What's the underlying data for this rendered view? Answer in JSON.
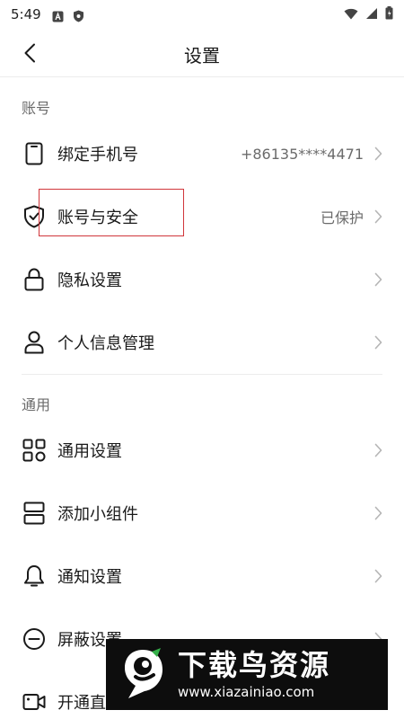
{
  "status": {
    "time": "5:49"
  },
  "nav": {
    "title": "设置"
  },
  "sections": {
    "account_header": "账号",
    "general_header": "通用"
  },
  "account_rows": [
    {
      "label": "绑定手机号",
      "value": "+86135****4471"
    },
    {
      "label": "账号与安全",
      "value": "已保护"
    },
    {
      "label": "隐私设置",
      "value": ""
    },
    {
      "label": "个人信息管理",
      "value": ""
    }
  ],
  "general_rows": [
    {
      "label": "通用设置"
    },
    {
      "label": "添加小组件"
    },
    {
      "label": "通知设置"
    },
    {
      "label": "屏蔽设置"
    },
    {
      "label": "开通直"
    }
  ],
  "watermark": {
    "title": "下载鸟资源",
    "url": "www.xiazainiao.com"
  },
  "colors": {
    "highlight": "#d1363b",
    "secondary_text": "#6b6b6b"
  }
}
